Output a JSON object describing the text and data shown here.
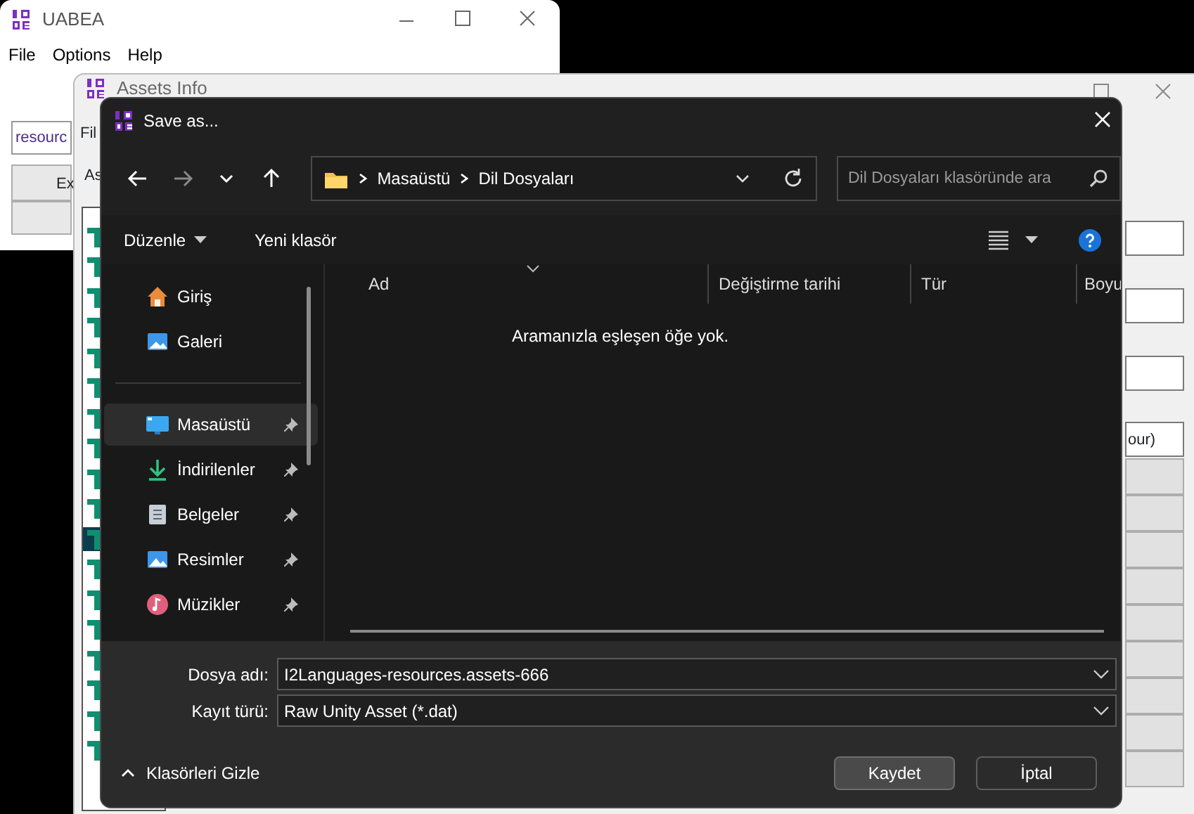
{
  "uabea_window": {
    "title": "UABEA",
    "menu": [
      "File",
      "Options",
      "Help"
    ],
    "search_value": "resourc",
    "button_label": "Ex"
  },
  "assets_window": {
    "title": "Assets Info",
    "menu_label": "Fil",
    "list_label": "As",
    "type_field_value": "our)",
    "asset_rows": [
      {
        "selected": false
      },
      {
        "selected": false
      },
      {
        "selected": false
      },
      {
        "selected": false
      },
      {
        "selected": false
      },
      {
        "selected": false
      },
      {
        "selected": false
      },
      {
        "selected": false
      },
      {
        "selected": false
      },
      {
        "selected": false
      },
      {
        "selected": true
      },
      {
        "selected": false
      },
      {
        "selected": false
      },
      {
        "selected": false
      },
      {
        "selected": false
      },
      {
        "selected": false
      },
      {
        "selected": false
      },
      {
        "selected": false
      }
    ]
  },
  "dialog": {
    "title": "Save as...",
    "path": [
      "Masaüstü",
      "Dil Dosyaları"
    ],
    "search_placeholder": "Dil Dosyaları klasöründe ara",
    "commands": [
      "Düzenle",
      "Yeni klasör"
    ],
    "sidebar_sections": [
      {
        "items": [
          {
            "label": "Giriş",
            "kind": "home",
            "selected": false,
            "pinned": false
          },
          {
            "label": "Galeri",
            "kind": "gallery",
            "selected": false,
            "pinned": false
          }
        ]
      },
      {
        "items": [
          {
            "label": "Masaüstü",
            "kind": "desktop",
            "selected": true,
            "pinned": true
          },
          {
            "label": "İndirilenler",
            "kind": "downloads",
            "selected": false,
            "pinned": true
          },
          {
            "label": "Belgeler",
            "kind": "documents",
            "selected": false,
            "pinned": true
          },
          {
            "label": "Resimler",
            "kind": "pictures",
            "selected": false,
            "pinned": true
          },
          {
            "label": "Müzikler",
            "kind": "music",
            "selected": false,
            "pinned": true
          }
        ]
      }
    ],
    "columns": [
      "Ad",
      "Değiştirme tarihi",
      "Tür",
      "Boyu"
    ],
    "empty_message": "Aramanızla eşleşen öğe yok.",
    "filename_label": "Dosya adı:",
    "filename": "I2Languages-resources.assets-666",
    "type_label": "Kayıt türü:",
    "type": "Raw Unity Asset (*.dat)",
    "folders_toggle": "Klasörleri Gizle",
    "buttons": [
      {
        "label": "Kaydet",
        "kind": "primary"
      },
      {
        "label": "İptal",
        "kind": "secondary"
      }
    ]
  }
}
